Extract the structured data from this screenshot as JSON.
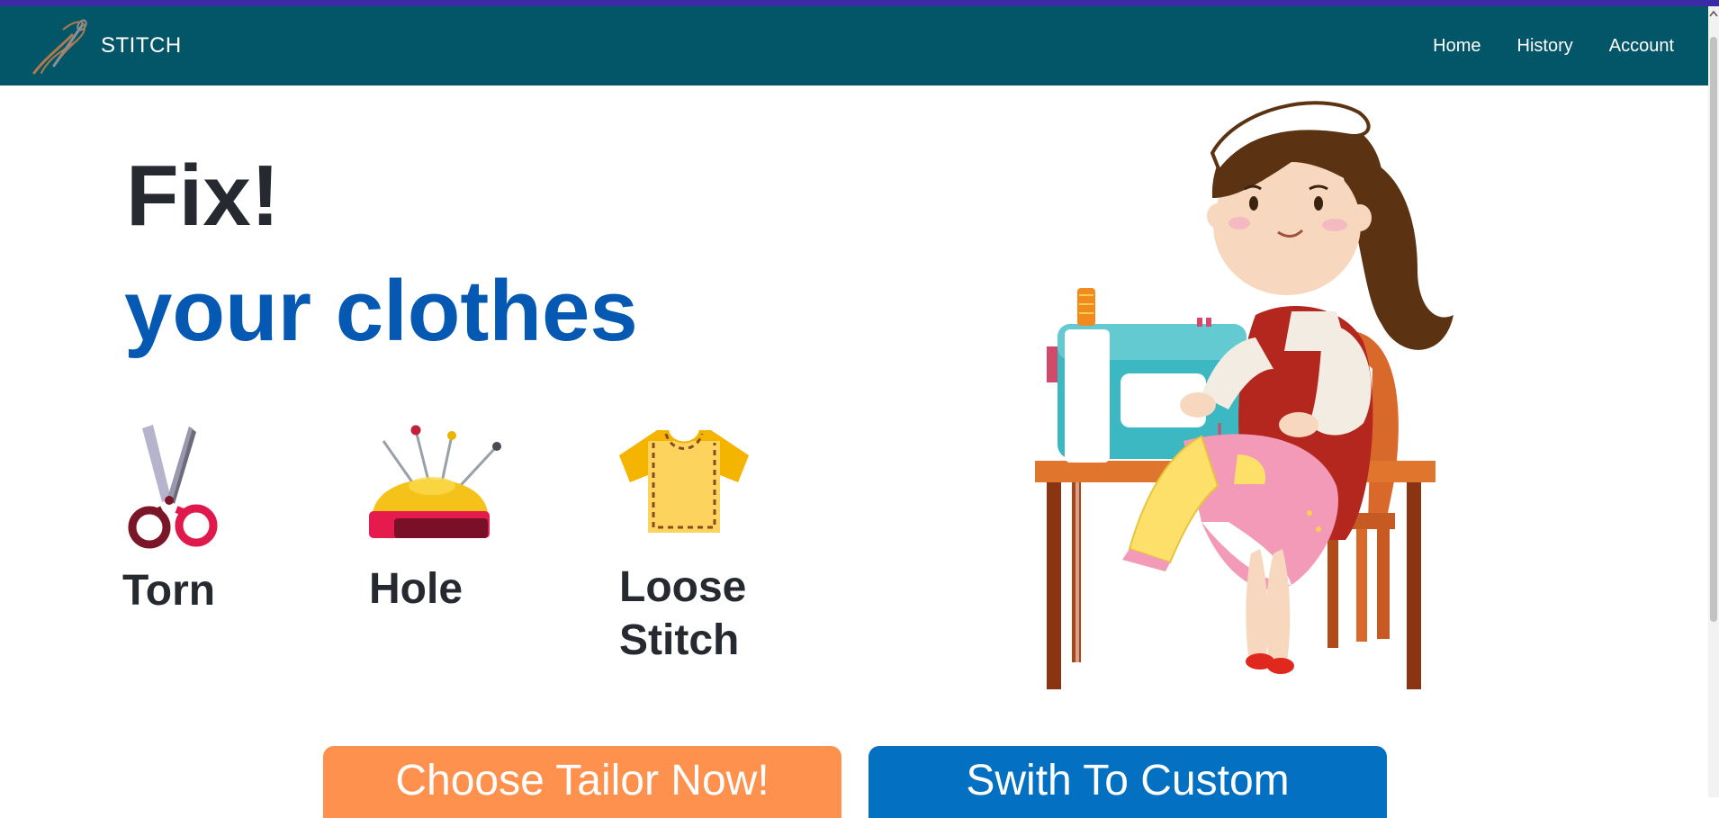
{
  "app": {
    "brand": "STITCH"
  },
  "nav": {
    "items": [
      "Home",
      "History",
      "Account"
    ]
  },
  "hero": {
    "line1": "Fix!",
    "line2": "your clothes"
  },
  "options": [
    {
      "label": "Torn",
      "icon": "scissors-icon"
    },
    {
      "label": "Hole",
      "icon": "pincushion-icon"
    },
    {
      "label": "Loose Stitch",
      "icon": "tshirt-icon"
    }
  ],
  "actions": {
    "choose_tailor": "Choose Tailor Now!",
    "switch_custom": "Swith To Custom"
  },
  "colors": {
    "navbar": "#035667",
    "top_strip": "#3b2aa6",
    "heading_dark": "#262a30",
    "heading_blue": "#0659b2",
    "tailor_button": "#fe914d",
    "custom_button": "#0370c2"
  }
}
